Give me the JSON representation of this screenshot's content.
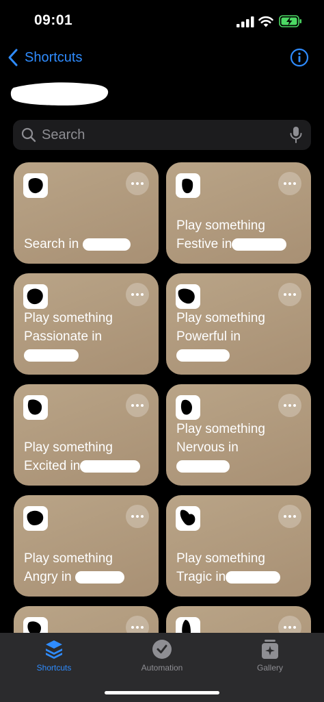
{
  "status_bar": {
    "time": "09:01",
    "signal_icon": "cellular-signal-icon",
    "wifi_icon": "wifi-icon",
    "battery_icon": "battery-charging-icon",
    "battery_color": "#4cd964"
  },
  "nav": {
    "back_label": "Shortcuts",
    "back_icon": "chevron-left-icon",
    "info_icon": "info-icon",
    "accent": "#2f8cff"
  },
  "search": {
    "placeholder": "Search",
    "icon": "search-icon",
    "mic_icon": "microphone-icon"
  },
  "card_color": "#b9a487",
  "cards": [
    {
      "line1": "Search in",
      "line2": ""
    },
    {
      "line1": "Play something",
      "line2": "Festive in"
    },
    {
      "line1": "Play something",
      "line2": "Passionate in"
    },
    {
      "line1": "Play something",
      "line2": "Powerful in"
    },
    {
      "line1": "Play something",
      "line2": "Excited in"
    },
    {
      "line1": "Play something",
      "line2": "Nervous in"
    },
    {
      "line1": "Play something",
      "line2": "Angry in"
    },
    {
      "line1": "Play something",
      "line2": "Tragic in"
    },
    {
      "line1": "",
      "line2": ""
    },
    {
      "line1": "",
      "line2": ""
    }
  ],
  "tabs": [
    {
      "label": "Shortcuts",
      "icon": "shortcuts-stack-icon",
      "active": true
    },
    {
      "label": "Automation",
      "icon": "automation-clock-icon",
      "active": false
    },
    {
      "label": "Gallery",
      "icon": "gallery-sparkle-icon",
      "active": false
    }
  ]
}
